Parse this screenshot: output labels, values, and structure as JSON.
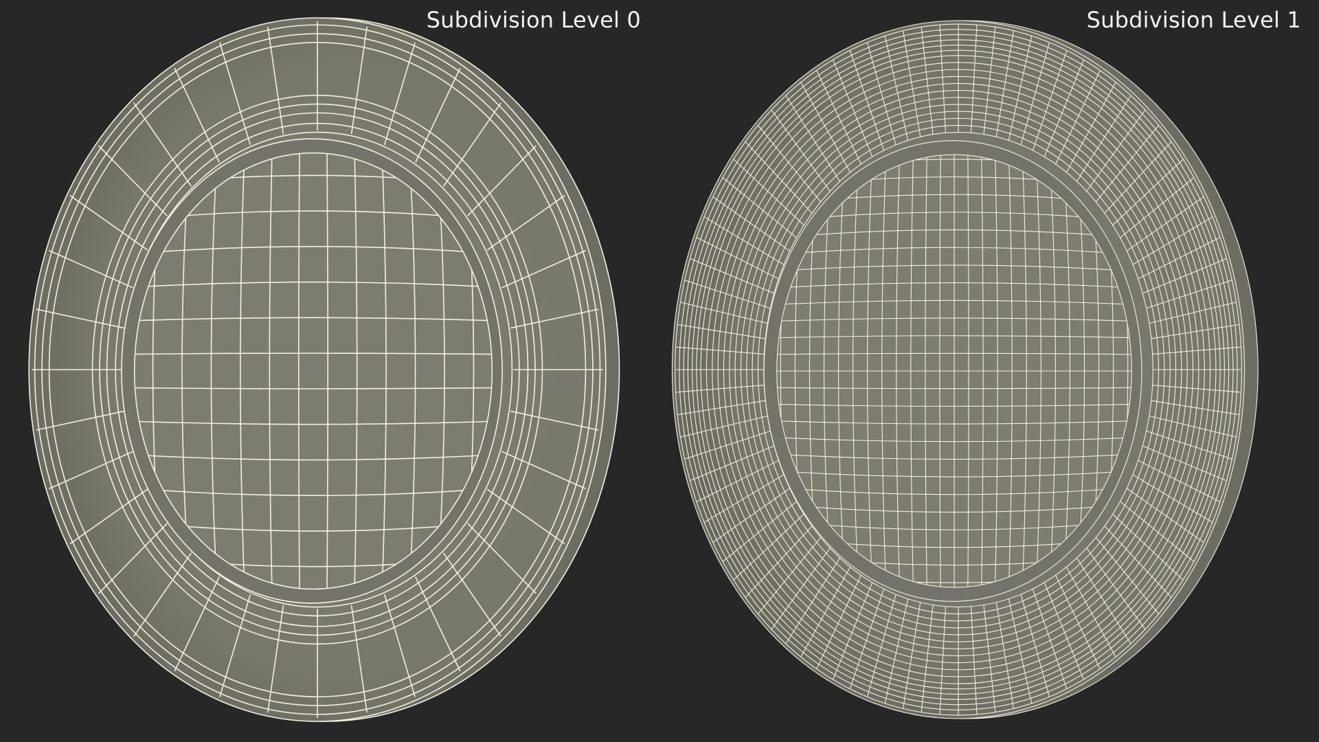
{
  "panels": [
    {
      "label": "Subdivision Level 0",
      "subdivision_level": 0
    },
    {
      "label": "Subdivision Level 1",
      "subdivision_level": 1
    }
  ],
  "colors": {
    "background": "#272727",
    "surface": "#7b7b6f",
    "surface_shadow": "#5f5f55",
    "wire": "#f3f1df",
    "label": "#f2f2f2"
  }
}
